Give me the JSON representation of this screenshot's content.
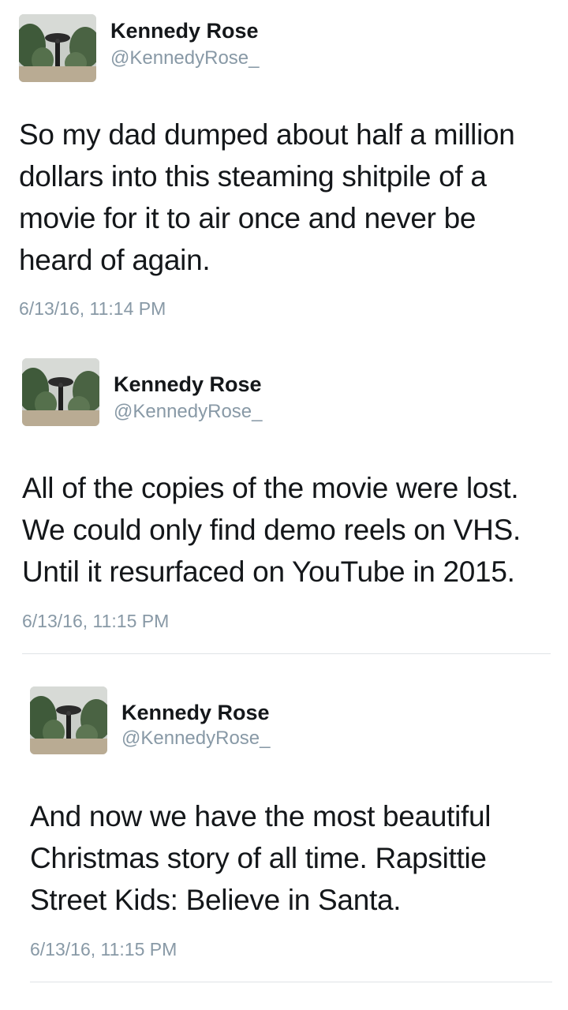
{
  "tweets": [
    {
      "name": "Kennedy Rose",
      "handle": "@KennedyRose_",
      "lines": [
        "So my dad dumped about half a million",
        "dollars into this steaming shitpile of a",
        "movie for it to air once and never be",
        "heard of again."
      ],
      "timestamp": "6/13/16, 11:14 PM"
    },
    {
      "name": "Kennedy Rose",
      "handle": "@KennedyRose_",
      "lines": [
        "All of the copies of the movie were lost.",
        "We could only find demo reels on VHS.",
        "Until it resurfaced on YouTube in 2015."
      ],
      "timestamp": "6/13/16, 11:15 PM"
    },
    {
      "name": "Kennedy Rose",
      "handle": "@KennedyRose_",
      "lines": [
        "And now we have the most beautiful",
        "Christmas story of all time. Rapsittie",
        "Street Kids: Believe in Santa."
      ],
      "timestamp": "6/13/16, 11:15 PM"
    }
  ],
  "colors": {
    "text": "#14171a",
    "secondary": "#8899a6",
    "divider": "#dfe3e6"
  }
}
